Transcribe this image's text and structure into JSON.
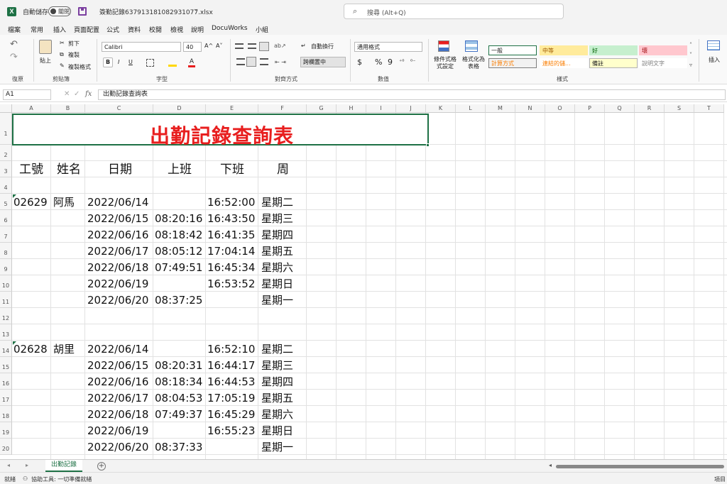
{
  "app": {
    "autosave_label": "自動儲存",
    "autosave_state": "關閉",
    "filename": "簽勤記錄637913181082931077.xlsx",
    "dropdown": "⌄",
    "search_placeholder": "搜尋 (Alt+Q)"
  },
  "menu": {
    "tabs": [
      "檔案",
      "常用",
      "插入",
      "頁面配置",
      "公式",
      "資料",
      "校閱",
      "檢視",
      "說明",
      "DocuWorks",
      "小組"
    ],
    "active": "常用"
  },
  "ribbon": {
    "clipboard": {
      "paste": "貼上",
      "cut": "剪下",
      "copy": "複製",
      "format_painter": "複製格式",
      "label": "剪貼簿"
    },
    "undo": {
      "label": "復原"
    },
    "font": {
      "name": "Calibri",
      "size": "40",
      "grow": "A^",
      "shrink": "A˅",
      "bold": "B",
      "italic": "I",
      "underline": "U",
      "label": "字型"
    },
    "alignment": {
      "wrap": "自動換行",
      "merge": "跨欄置中",
      "label": "對齊方式"
    },
    "number": {
      "format": "通用格式",
      "currency": "$",
      "percent": "%",
      "comma": "9",
      "label": "數值"
    },
    "styles": {
      "conditional": "條件式格式設定",
      "table": "格式化為表格",
      "cells": [
        {
          "text": "一般",
          "bg": "#ffffff",
          "fg": "#222222",
          "border": "#1e7145"
        },
        {
          "text": "中等",
          "bg": "#ffeb9c",
          "fg": "#9c5700",
          "border": "#ffeb9c"
        },
        {
          "text": "好",
          "bg": "#c6efce",
          "fg": "#006100",
          "border": "#c6efce"
        },
        {
          "text": "壞",
          "bg": "#ffc7ce",
          "fg": "#9c0006",
          "border": "#ffc7ce"
        },
        {
          "text": "計算方式",
          "bg": "#f2f2f2",
          "fg": "#fa7d00",
          "border": "#7f7f7f"
        },
        {
          "text": "連結的儲...",
          "bg": "#ffffff",
          "fg": "#fa7d00",
          "border": "#ffffff"
        },
        {
          "text": "備註",
          "bg": "#ffffcc",
          "fg": "#222222",
          "border": "#b2b2b2"
        },
        {
          "text": "說明文字",
          "bg": "#ffffff",
          "fg": "#7f7f7f",
          "border": "#ffffff"
        }
      ],
      "label": "樣式"
    },
    "insert": {
      "label": "插入"
    }
  },
  "formula_bar": {
    "cell_ref": "A1",
    "fx": "fx",
    "content": "出勤記錄查詢表"
  },
  "columns": [
    "A",
    "B",
    "C",
    "D",
    "E",
    "F",
    "G",
    "H",
    "I",
    "J",
    "K",
    "L",
    "M",
    "N",
    "O",
    "P",
    "Q",
    "R",
    "S",
    "T"
  ],
  "rows": [
    "1",
    "2",
    "3",
    "4",
    "5",
    "6",
    "7",
    "8",
    "9",
    "10",
    "11",
    "12",
    "13",
    "14",
    "15",
    "16",
    "17",
    "18",
    "19",
    "20"
  ],
  "sheet": {
    "title": "出勤記錄查詢表",
    "headers": [
      "工號",
      "姓名",
      "日期",
      "上班",
      "下班",
      "周"
    ],
    "groups": [
      {
        "id": "02629",
        "name": "阿馬",
        "records": [
          {
            "date": "2022/06/14",
            "in": "",
            "out": "16:52:00",
            "day": "星期二"
          },
          {
            "date": "2022/06/15",
            "in": "08:20:16",
            "out": "16:43:50",
            "day": "星期三"
          },
          {
            "date": "2022/06/16",
            "in": "08:18:42",
            "out": "16:41:35",
            "day": "星期四"
          },
          {
            "date": "2022/06/17",
            "in": "08:05:12",
            "out": "17:04:14",
            "day": "星期五"
          },
          {
            "date": "2022/06/18",
            "in": "07:49:51",
            "out": "16:45:34",
            "day": "星期六"
          },
          {
            "date": "2022/06/19",
            "in": "",
            "out": "16:53:52",
            "day": "星期日"
          },
          {
            "date": "2022/06/20",
            "in": "08:37:25",
            "out": "",
            "day": "星期一"
          }
        ]
      },
      {
        "id": "02628",
        "name": "胡里",
        "records": [
          {
            "date": "2022/06/14",
            "in": "",
            "out": "16:52:10",
            "day": "星期二"
          },
          {
            "date": "2022/06/15",
            "in": "08:20:31",
            "out": "16:44:17",
            "day": "星期三"
          },
          {
            "date": "2022/06/16",
            "in": "08:18:34",
            "out": "16:44:53",
            "day": "星期四"
          },
          {
            "date": "2022/06/17",
            "in": "08:04:53",
            "out": "17:05:19",
            "day": "星期五"
          },
          {
            "date": "2022/06/18",
            "in": "07:49:37",
            "out": "16:45:29",
            "day": "星期六"
          },
          {
            "date": "2022/06/19",
            "in": "",
            "out": "16:55:23",
            "day": "星期日"
          },
          {
            "date": "2022/06/20",
            "in": "08:37:33",
            "out": "",
            "day": "星期一"
          }
        ]
      }
    ]
  },
  "sheet_tabs": {
    "active": "出勤記錄",
    "add": "+"
  },
  "status": {
    "ready": "就緒",
    "accessibility": "協助工具: 一切準備就緒",
    "right": "項目"
  }
}
